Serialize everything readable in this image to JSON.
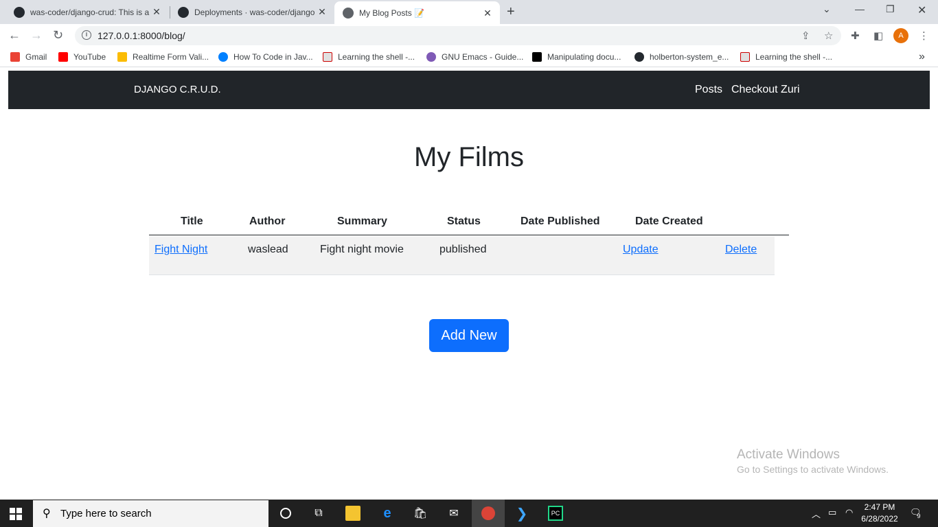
{
  "browser": {
    "tabs": [
      {
        "title": "was-coder/django-crud: This is a",
        "close": "✕"
      },
      {
        "title": "Deployments · was-coder/django",
        "close": "✕"
      },
      {
        "title": "My Blog Posts 📝",
        "close": "✕"
      }
    ],
    "new_tab": "+",
    "url": "127.0.0.1:8000/blog/",
    "bookmarks": [
      "Gmail",
      "YouTube",
      "Realtime Form Vali...",
      "How To Code in Jav...",
      "Learning the shell -...",
      "GNU Emacs - Guide...",
      "Manipulating docu...",
      "holberton-system_e...",
      "Learning the shell -..."
    ],
    "profile_initial": "A",
    "more_bookmarks": "»"
  },
  "navbar": {
    "brand": "DJANGO C.R.U.D.",
    "links": [
      "Posts",
      "Checkout Zuri"
    ]
  },
  "page": {
    "heading": "My Films",
    "table": {
      "headers": [
        "Title",
        "Author",
        "Summary",
        "Status",
        "Date Published",
        "Date Created"
      ],
      "rows": [
        {
          "title": "Fight Night",
          "author": "waslead",
          "summary": "Fight night movie",
          "status": "published",
          "date_published": "",
          "update": "Update",
          "delete": "Delete"
        }
      ]
    },
    "add_button": "Add New"
  },
  "watermark": {
    "line1": "Activate Windows",
    "line2": "Go to Settings to activate Windows."
  },
  "taskbar": {
    "search_placeholder": "Type here to search",
    "time": "2:47 PM",
    "date": "6/28/2022",
    "notifications": "9"
  }
}
